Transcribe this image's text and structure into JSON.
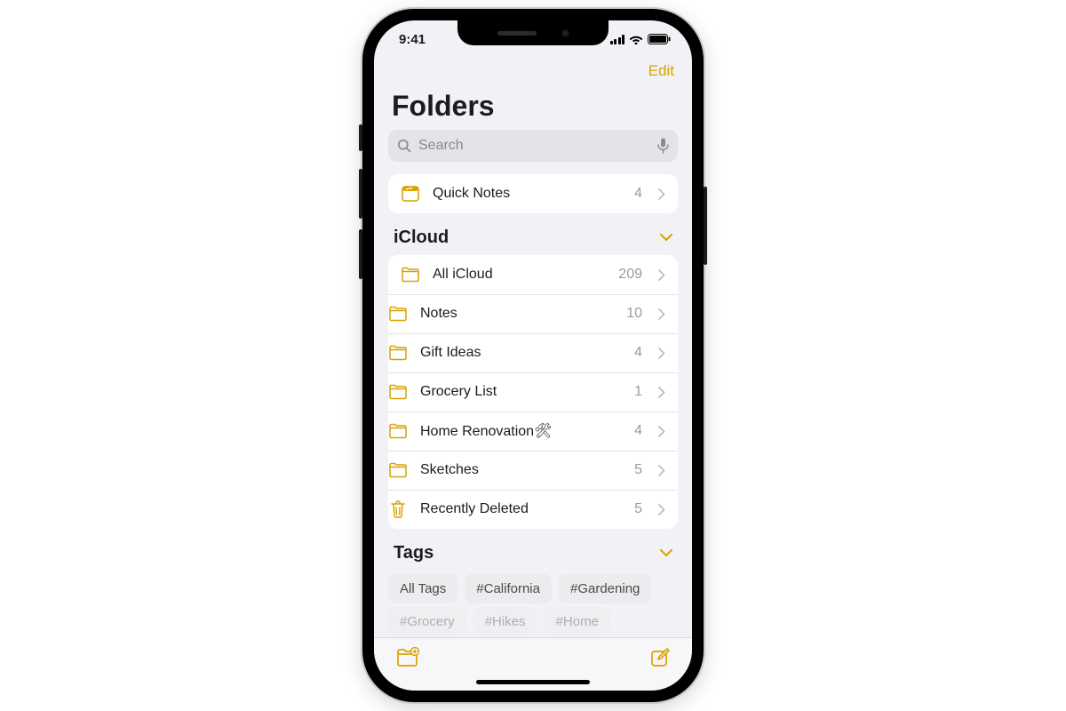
{
  "status": {
    "time": "9:41"
  },
  "nav": {
    "edit": "Edit"
  },
  "title": "Folders",
  "search": {
    "placeholder": "Search"
  },
  "quick_notes": {
    "label": "Quick Notes",
    "count": "4"
  },
  "sections": {
    "icloud": {
      "title": "iCloud",
      "folders": [
        {
          "label": "All iCloud",
          "count": "209"
        },
        {
          "label": "Notes",
          "count": "10"
        },
        {
          "label": "Gift Ideas",
          "count": "4"
        },
        {
          "label": "Grocery List",
          "count": "1"
        },
        {
          "label": "Home Renovation🛠",
          "count": "4"
        },
        {
          "label": "Sketches",
          "count": "5"
        },
        {
          "label": "Recently Deleted",
          "count": "5"
        }
      ]
    },
    "tags": {
      "title": "Tags",
      "items": [
        "All Tags",
        "#California",
        "#Gardening"
      ],
      "items_row2": [
        "#Grocery",
        "#Hikes",
        "#Home"
      ]
    }
  },
  "colors": {
    "accent": "#d9a200"
  }
}
